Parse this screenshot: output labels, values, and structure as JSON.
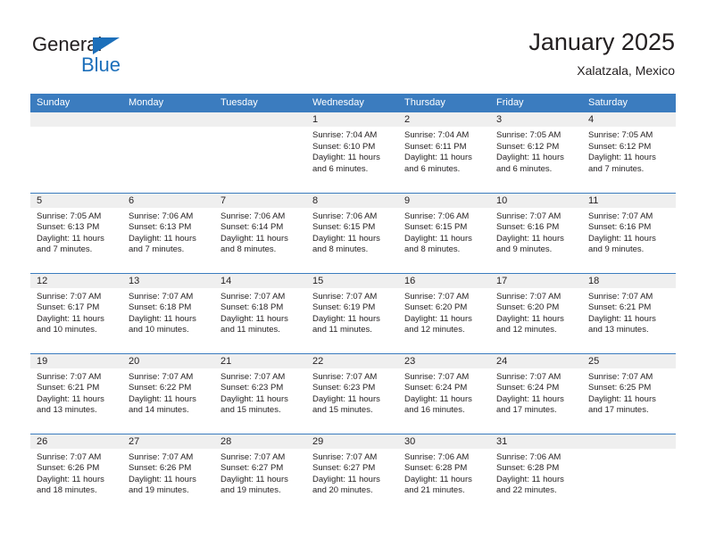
{
  "logo": {
    "word_one": "General",
    "word_two": "Blue",
    "triangle_color": "#1c6fba",
    "text_color": "#231f20"
  },
  "header": {
    "title": "January 2025",
    "subtitle": "Xalatzala, Mexico"
  },
  "theme": {
    "header_blue": "#3b7cbf",
    "daynum_band": "#efefef",
    "text": "#231f20"
  },
  "weekday_headers": [
    "Sunday",
    "Monday",
    "Tuesday",
    "Wednesday",
    "Thursday",
    "Friday",
    "Saturday"
  ],
  "weeks": [
    [
      {
        "day": "",
        "sunrise": "",
        "sunset": "",
        "daylight_line1": "",
        "daylight_line2": ""
      },
      {
        "day": "",
        "sunrise": "",
        "sunset": "",
        "daylight_line1": "",
        "daylight_line2": ""
      },
      {
        "day": "",
        "sunrise": "",
        "sunset": "",
        "daylight_line1": "",
        "daylight_line2": ""
      },
      {
        "day": "1",
        "sunrise": "Sunrise: 7:04 AM",
        "sunset": "Sunset: 6:10 PM",
        "daylight_line1": "Daylight: 11 hours",
        "daylight_line2": "and 6 minutes."
      },
      {
        "day": "2",
        "sunrise": "Sunrise: 7:04 AM",
        "sunset": "Sunset: 6:11 PM",
        "daylight_line1": "Daylight: 11 hours",
        "daylight_line2": "and 6 minutes."
      },
      {
        "day": "3",
        "sunrise": "Sunrise: 7:05 AM",
        "sunset": "Sunset: 6:12 PM",
        "daylight_line1": "Daylight: 11 hours",
        "daylight_line2": "and 6 minutes."
      },
      {
        "day": "4",
        "sunrise": "Sunrise: 7:05 AM",
        "sunset": "Sunset: 6:12 PM",
        "daylight_line1": "Daylight: 11 hours",
        "daylight_line2": "and 7 minutes."
      }
    ],
    [
      {
        "day": "5",
        "sunrise": "Sunrise: 7:05 AM",
        "sunset": "Sunset: 6:13 PM",
        "daylight_line1": "Daylight: 11 hours",
        "daylight_line2": "and 7 minutes."
      },
      {
        "day": "6",
        "sunrise": "Sunrise: 7:06 AM",
        "sunset": "Sunset: 6:13 PM",
        "daylight_line1": "Daylight: 11 hours",
        "daylight_line2": "and 7 minutes."
      },
      {
        "day": "7",
        "sunrise": "Sunrise: 7:06 AM",
        "sunset": "Sunset: 6:14 PM",
        "daylight_line1": "Daylight: 11 hours",
        "daylight_line2": "and 8 minutes."
      },
      {
        "day": "8",
        "sunrise": "Sunrise: 7:06 AM",
        "sunset": "Sunset: 6:15 PM",
        "daylight_line1": "Daylight: 11 hours",
        "daylight_line2": "and 8 minutes."
      },
      {
        "day": "9",
        "sunrise": "Sunrise: 7:06 AM",
        "sunset": "Sunset: 6:15 PM",
        "daylight_line1": "Daylight: 11 hours",
        "daylight_line2": "and 8 minutes."
      },
      {
        "day": "10",
        "sunrise": "Sunrise: 7:07 AM",
        "sunset": "Sunset: 6:16 PM",
        "daylight_line1": "Daylight: 11 hours",
        "daylight_line2": "and 9 minutes."
      },
      {
        "day": "11",
        "sunrise": "Sunrise: 7:07 AM",
        "sunset": "Sunset: 6:16 PM",
        "daylight_line1": "Daylight: 11 hours",
        "daylight_line2": "and 9 minutes."
      }
    ],
    [
      {
        "day": "12",
        "sunrise": "Sunrise: 7:07 AM",
        "sunset": "Sunset: 6:17 PM",
        "daylight_line1": "Daylight: 11 hours",
        "daylight_line2": "and 10 minutes."
      },
      {
        "day": "13",
        "sunrise": "Sunrise: 7:07 AM",
        "sunset": "Sunset: 6:18 PM",
        "daylight_line1": "Daylight: 11 hours",
        "daylight_line2": "and 10 minutes."
      },
      {
        "day": "14",
        "sunrise": "Sunrise: 7:07 AM",
        "sunset": "Sunset: 6:18 PM",
        "daylight_line1": "Daylight: 11 hours",
        "daylight_line2": "and 11 minutes."
      },
      {
        "day": "15",
        "sunrise": "Sunrise: 7:07 AM",
        "sunset": "Sunset: 6:19 PM",
        "daylight_line1": "Daylight: 11 hours",
        "daylight_line2": "and 11 minutes."
      },
      {
        "day": "16",
        "sunrise": "Sunrise: 7:07 AM",
        "sunset": "Sunset: 6:20 PM",
        "daylight_line1": "Daylight: 11 hours",
        "daylight_line2": "and 12 minutes."
      },
      {
        "day": "17",
        "sunrise": "Sunrise: 7:07 AM",
        "sunset": "Sunset: 6:20 PM",
        "daylight_line1": "Daylight: 11 hours",
        "daylight_line2": "and 12 minutes."
      },
      {
        "day": "18",
        "sunrise": "Sunrise: 7:07 AM",
        "sunset": "Sunset: 6:21 PM",
        "daylight_line1": "Daylight: 11 hours",
        "daylight_line2": "and 13 minutes."
      }
    ],
    [
      {
        "day": "19",
        "sunrise": "Sunrise: 7:07 AM",
        "sunset": "Sunset: 6:21 PM",
        "daylight_line1": "Daylight: 11 hours",
        "daylight_line2": "and 13 minutes."
      },
      {
        "day": "20",
        "sunrise": "Sunrise: 7:07 AM",
        "sunset": "Sunset: 6:22 PM",
        "daylight_line1": "Daylight: 11 hours",
        "daylight_line2": "and 14 minutes."
      },
      {
        "day": "21",
        "sunrise": "Sunrise: 7:07 AM",
        "sunset": "Sunset: 6:23 PM",
        "daylight_line1": "Daylight: 11 hours",
        "daylight_line2": "and 15 minutes."
      },
      {
        "day": "22",
        "sunrise": "Sunrise: 7:07 AM",
        "sunset": "Sunset: 6:23 PM",
        "daylight_line1": "Daylight: 11 hours",
        "daylight_line2": "and 15 minutes."
      },
      {
        "day": "23",
        "sunrise": "Sunrise: 7:07 AM",
        "sunset": "Sunset: 6:24 PM",
        "daylight_line1": "Daylight: 11 hours",
        "daylight_line2": "and 16 minutes."
      },
      {
        "day": "24",
        "sunrise": "Sunrise: 7:07 AM",
        "sunset": "Sunset: 6:24 PM",
        "daylight_line1": "Daylight: 11 hours",
        "daylight_line2": "and 17 minutes."
      },
      {
        "day": "25",
        "sunrise": "Sunrise: 7:07 AM",
        "sunset": "Sunset: 6:25 PM",
        "daylight_line1": "Daylight: 11 hours",
        "daylight_line2": "and 17 minutes."
      }
    ],
    [
      {
        "day": "26",
        "sunrise": "Sunrise: 7:07 AM",
        "sunset": "Sunset: 6:26 PM",
        "daylight_line1": "Daylight: 11 hours",
        "daylight_line2": "and 18 minutes."
      },
      {
        "day": "27",
        "sunrise": "Sunrise: 7:07 AM",
        "sunset": "Sunset: 6:26 PM",
        "daylight_line1": "Daylight: 11 hours",
        "daylight_line2": "and 19 minutes."
      },
      {
        "day": "28",
        "sunrise": "Sunrise: 7:07 AM",
        "sunset": "Sunset: 6:27 PM",
        "daylight_line1": "Daylight: 11 hours",
        "daylight_line2": "and 19 minutes."
      },
      {
        "day": "29",
        "sunrise": "Sunrise: 7:07 AM",
        "sunset": "Sunset: 6:27 PM",
        "daylight_line1": "Daylight: 11 hours",
        "daylight_line2": "and 20 minutes."
      },
      {
        "day": "30",
        "sunrise": "Sunrise: 7:06 AM",
        "sunset": "Sunset: 6:28 PM",
        "daylight_line1": "Daylight: 11 hours",
        "daylight_line2": "and 21 minutes."
      },
      {
        "day": "31",
        "sunrise": "Sunrise: 7:06 AM",
        "sunset": "Sunset: 6:28 PM",
        "daylight_line1": "Daylight: 11 hours",
        "daylight_line2": "and 22 minutes."
      },
      {
        "day": "",
        "sunrise": "",
        "sunset": "",
        "daylight_line1": "",
        "daylight_line2": ""
      }
    ]
  ]
}
